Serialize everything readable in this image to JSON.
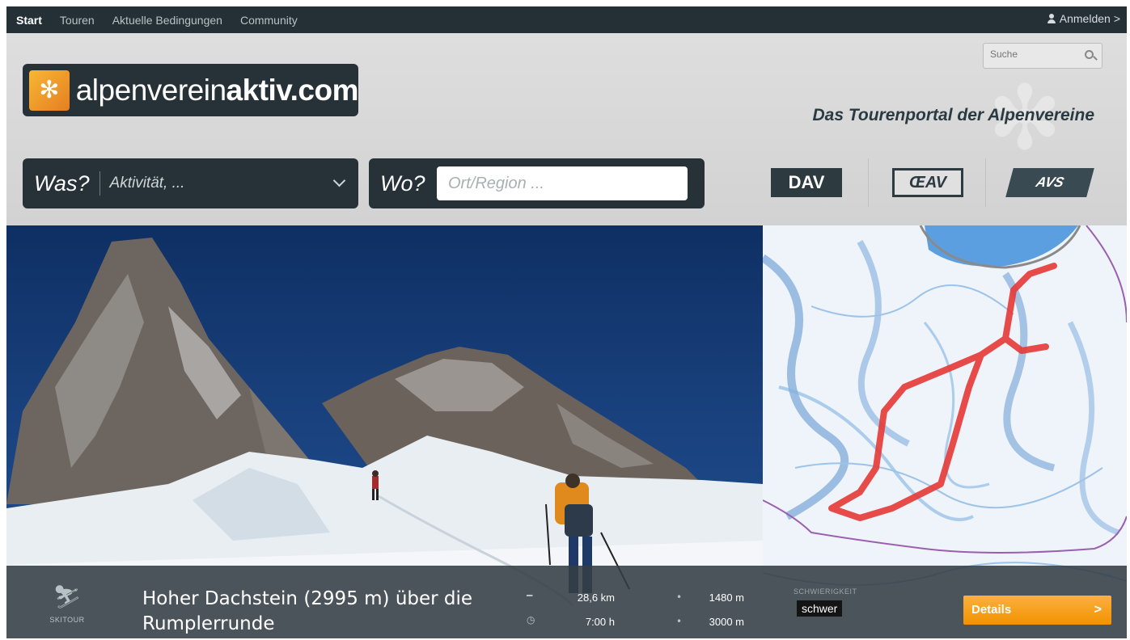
{
  "topnav": {
    "items": [
      "Start",
      "Touren",
      "Aktuelle Bedingungen",
      "Community"
    ],
    "login": "Anmelden",
    "login_chevron": ">"
  },
  "header": {
    "logo_text_light": "alpenverein",
    "logo_text_bold": "aktiv.com",
    "search_placeholder": "Suche",
    "tagline": "Das Tourenportal der Alpenvereine"
  },
  "search_bar": {
    "was_label": "Was?",
    "was_value": "Aktivität, ...",
    "wo_label": "Wo?",
    "wo_placeholder": "Ort/Region ..."
  },
  "partners": [
    "DAV",
    "ŒAV",
    "AVS"
  ],
  "tour": {
    "activity": "SKITOUR",
    "title": "Hoher Dachstein (2995 m) über die Rumplerrunde",
    "distance": "28,6 km",
    "duration": "7:00 h",
    "ascent": "1480 m",
    "altitude": "3000 m",
    "difficulty_label": "SCHWIERIGKEIT",
    "difficulty": "schwer",
    "details_label": "Details",
    "details_arrow": ">"
  },
  "colors": {
    "nav_bg": "#243036",
    "box_bg": "#263238",
    "accent": "#f39200",
    "route": "#e53935"
  }
}
